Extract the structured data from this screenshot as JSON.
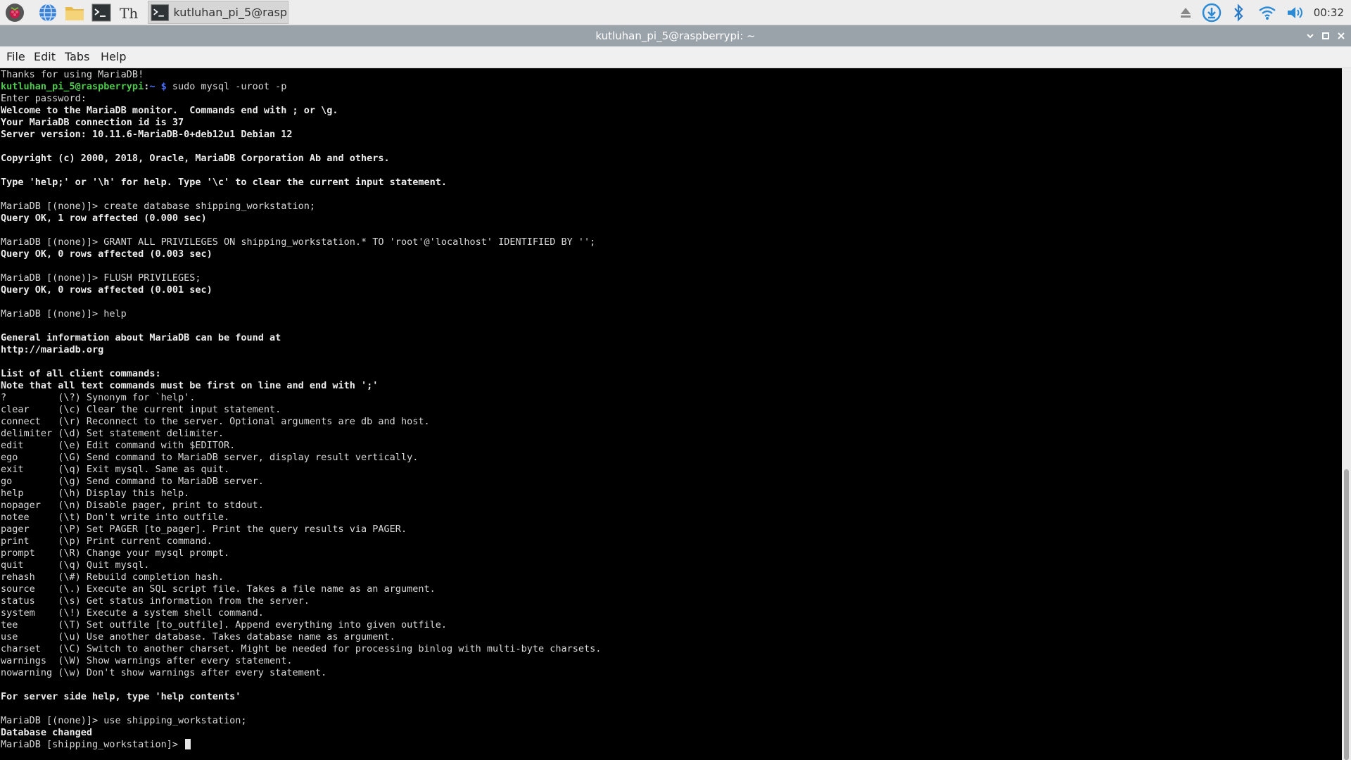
{
  "taskbar": {
    "launchers": [
      "raspberry-menu-icon",
      "web-browser-icon",
      "file-manager-icon",
      "terminal-icon",
      "text-editor-icon"
    ],
    "task": {
      "label": "kutluhan_pi_5@rasp.."
    },
    "clock": "00:32"
  },
  "window": {
    "title": "kutluhan_pi_5@raspberrypi: ~"
  },
  "menu": {
    "items": [
      "File",
      "Edit",
      "Tabs",
      "Help"
    ]
  },
  "terminal": {
    "prompt": {
      "user": "kutluhan_pi_5@raspberrypi",
      "colon": ":",
      "path": "~",
      "dollar": " $",
      "command": " sudo mysql -uroot -p"
    },
    "lines_before": [
      {
        "t": "Thanks for using MariaDB!",
        "b": false
      }
    ],
    "lines": [
      {
        "t": "Enter password:",
        "b": false
      },
      {
        "t": "Welcome to the MariaDB monitor.  Commands end with ; or \\g.",
        "b": true
      },
      {
        "t": "Your MariaDB connection id is 37",
        "b": true
      },
      {
        "t": "Server version: 10.11.6-MariaDB-0+deb12u1 Debian 12",
        "b": true
      },
      {
        "t": "",
        "b": false
      },
      {
        "t": "Copyright (c) 2000, 2018, Oracle, MariaDB Corporation Ab and others.",
        "b": true
      },
      {
        "t": "",
        "b": false
      },
      {
        "t": "Type 'help;' or '\\h' for help. Type '\\c' to clear the current input statement.",
        "b": true
      },
      {
        "t": "",
        "b": false
      },
      {
        "t": "MariaDB [(none)]> create database shipping_workstation;",
        "b": false
      },
      {
        "t": "Query OK, 1 row affected (0.000 sec)",
        "b": true
      },
      {
        "t": "",
        "b": false
      },
      {
        "t": "MariaDB [(none)]> GRANT ALL PRIVILEGES ON shipping_workstation.* TO 'root'@'localhost' IDENTIFIED BY '';",
        "b": false
      },
      {
        "t": "Query OK, 0 rows affected (0.003 sec)",
        "b": true
      },
      {
        "t": "",
        "b": false
      },
      {
        "t": "MariaDB [(none)]> FLUSH PRIVILEGES;",
        "b": false
      },
      {
        "t": "Query OK, 0 rows affected (0.001 sec)",
        "b": true
      },
      {
        "t": "",
        "b": false
      },
      {
        "t": "MariaDB [(none)]> help",
        "b": false
      },
      {
        "t": "",
        "b": false
      },
      {
        "t": "General information about MariaDB can be found at",
        "b": true
      },
      {
        "t": "http://mariadb.org",
        "b": true
      },
      {
        "t": "",
        "b": false
      },
      {
        "t": "List of all client commands:",
        "b": true
      },
      {
        "t": "Note that all text commands must be first on line and end with ';'",
        "b": true
      },
      {
        "t": "?         (\\?) Synonym for `help'.",
        "b": false
      },
      {
        "t": "clear     (\\c) Clear the current input statement.",
        "b": false
      },
      {
        "t": "connect   (\\r) Reconnect to the server. Optional arguments are db and host.",
        "b": false
      },
      {
        "t": "delimiter (\\d) Set statement delimiter.",
        "b": false
      },
      {
        "t": "edit      (\\e) Edit command with $EDITOR.",
        "b": false
      },
      {
        "t": "ego       (\\G) Send command to MariaDB server, display result vertically.",
        "b": false
      },
      {
        "t": "exit      (\\q) Exit mysql. Same as quit.",
        "b": false
      },
      {
        "t": "go        (\\g) Send command to MariaDB server.",
        "b": false
      },
      {
        "t": "help      (\\h) Display this help.",
        "b": false
      },
      {
        "t": "nopager   (\\n) Disable pager, print to stdout.",
        "b": false
      },
      {
        "t": "notee     (\\t) Don't write into outfile.",
        "b": false
      },
      {
        "t": "pager     (\\P) Set PAGER [to_pager]. Print the query results via PAGER.",
        "b": false
      },
      {
        "t": "print     (\\p) Print current command.",
        "b": false
      },
      {
        "t": "prompt    (\\R) Change your mysql prompt.",
        "b": false
      },
      {
        "t": "quit      (\\q) Quit mysql.",
        "b": false
      },
      {
        "t": "rehash    (\\#) Rebuild completion hash.",
        "b": false
      },
      {
        "t": "source    (\\.) Execute an SQL script file. Takes a file name as an argument.",
        "b": false
      },
      {
        "t": "status    (\\s) Get status information from the server.",
        "b": false
      },
      {
        "t": "system    (\\!) Execute a system shell command.",
        "b": false
      },
      {
        "t": "tee       (\\T) Set outfile [to_outfile]. Append everything into given outfile.",
        "b": false
      },
      {
        "t": "use       (\\u) Use another database. Takes database name as argument.",
        "b": false
      },
      {
        "t": "charset   (\\C) Switch to another charset. Might be needed for processing binlog with multi-byte charsets.",
        "b": false
      },
      {
        "t": "warnings  (\\W) Show warnings after every statement.",
        "b": false
      },
      {
        "t": "nowarning (\\w) Don't show warnings after every statement.",
        "b": false
      },
      {
        "t": "",
        "b": false
      },
      {
        "t": "For server side help, type 'help contents'",
        "b": true
      },
      {
        "t": "",
        "b": false
      },
      {
        "t": "MariaDB [(none)]> use shipping_workstation;",
        "b": false
      },
      {
        "t": "Database changed",
        "b": true
      }
    ],
    "current_prompt": "MariaDB [shipping_workstation]> "
  },
  "scrollbar": {
    "position_fraction": 0.58,
    "visible_fraction": 0.42
  }
}
